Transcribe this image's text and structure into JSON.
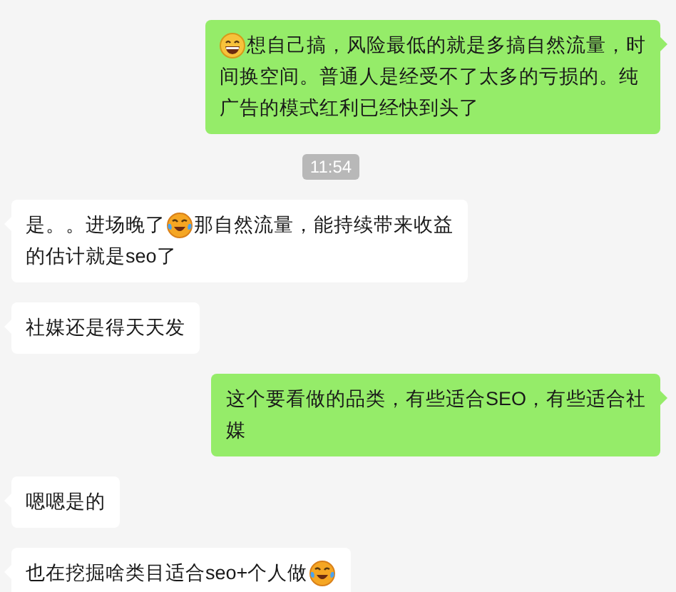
{
  "messages": [
    {
      "kind": "bubble",
      "from_me": true,
      "lines": [
        [
          {
            "kind": "grin"
          },
          {
            "kind": "text",
            "text": "想自己搞，风险最低的就是多搞自然流量，时"
          }
        ],
        [
          {
            "kind": "text",
            "text": "间换空间。普通人是经受不了太多的亏损的。纯"
          }
        ],
        [
          {
            "kind": "text",
            "text": "广告的模式红利已经快到头了"
          }
        ]
      ]
    },
    {
      "kind": "time",
      "text": "11:54"
    },
    {
      "kind": "bubble",
      "from_me": false,
      "lines": [
        [
          {
            "kind": "text",
            "text": "是。。进场晚了"
          },
          {
            "kind": "tears"
          },
          {
            "kind": "text",
            "text": "那自然流量，能持续带来收益"
          }
        ],
        [
          {
            "kind": "text",
            "text": "的估计就是seo了"
          }
        ]
      ]
    },
    {
      "kind": "bubble",
      "from_me": false,
      "lines": [
        [
          {
            "kind": "text",
            "text": "社媒还是得天天发"
          }
        ]
      ]
    },
    {
      "kind": "bubble",
      "from_me": true,
      "lines": [
        [
          {
            "kind": "text",
            "text": "这个要看做的品类，有些适合SEO，有些适合社"
          }
        ],
        [
          {
            "kind": "text",
            "text": "媒"
          }
        ]
      ]
    },
    {
      "kind": "bubble",
      "from_me": false,
      "lines": [
        [
          {
            "kind": "text",
            "text": "嗯嗯是的"
          }
        ]
      ]
    },
    {
      "kind": "bubble",
      "from_me": false,
      "lines": [
        [
          {
            "kind": "text",
            "text": "也在挖掘啥类目适合seo+个人做"
          },
          {
            "kind": "tears"
          }
        ]
      ]
    }
  ]
}
